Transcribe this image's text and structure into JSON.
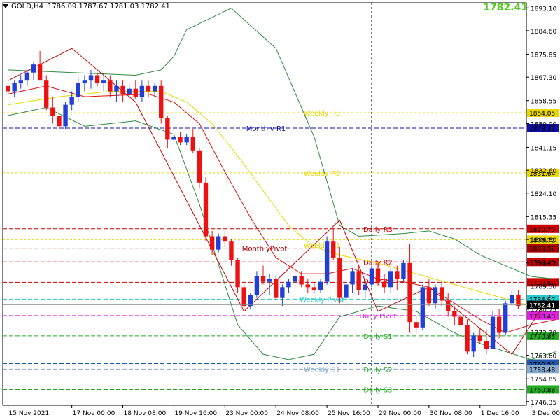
{
  "header": {
    "symbol_tf": "GOLD,H4",
    "ohlc": "1786.09 1787.67 1781.03 1782.41",
    "big_price": "1782.41"
  },
  "colors": {
    "bull": "#1f3fd8",
    "bear": "#ee1111",
    "grid": "#000000",
    "bb": "#2e8b3e",
    "ma_red": "#dd1111",
    "ma_yellow": "#e8d800",
    "zigzag": "#cc0000",
    "current_price_tag": "#000000"
  },
  "chart_data": {
    "type": "candlestick",
    "title": "GOLD,H4",
    "ylim": [
      1745,
      1895
    ],
    "y_ticks": [
      "1893.10",
      "1884.60",
      "1875.85",
      "1867.30",
      "1858.55",
      "1850.00",
      "1841.15",
      "1832.60",
      "1824.10",
      "1815.35",
      "1806.80",
      "1798.05",
      "1789.50",
      "1780.75",
      "1772.20",
      "1763.60",
      "1754.85",
      "1746.35"
    ],
    "x_ticks": [
      {
        "label": "15 Nov 2021",
        "x": 0
      },
      {
        "label": "17 Nov 00:00",
        "x": 10
      },
      {
        "label": "18 Nov 08:00",
        "x": 18
      },
      {
        "label": "19 Nov 16:00",
        "x": 26
      },
      {
        "label": "23 Nov 00:00",
        "x": 34
      },
      {
        "label": "24 Nov 08:00",
        "x": 42
      },
      {
        "label": "25 Nov 16:00",
        "x": 50
      },
      {
        "label": "29 Nov 00:00",
        "x": 58
      },
      {
        "label": "30 Nov 08:00",
        "x": 66
      },
      {
        "label": "1 Dec 16:00",
        "x": 74
      },
      {
        "label": "3 Dec 00:00",
        "x": 82
      }
    ],
    "vlines_x": [
      26,
      57,
      87
    ],
    "candles": [
      [
        1864,
        1866,
        1861,
        1862
      ],
      [
        1862,
        1866,
        1860,
        1865
      ],
      [
        1865,
        1868,
        1863,
        1866
      ],
      [
        1866,
        1870,
        1864,
        1869
      ],
      [
        1869,
        1873,
        1866,
        1872
      ],
      [
        1872,
        1877,
        1868,
        1866
      ],
      [
        1866,
        1868,
        1855,
        1856
      ],
      [
        1856,
        1860,
        1850,
        1853
      ],
      [
        1853,
        1856,
        1847,
        1849
      ],
      [
        1849,
        1858,
        1848,
        1857
      ],
      [
        1857,
        1862,
        1855,
        1860
      ],
      [
        1860,
        1867,
        1858,
        1865
      ],
      [
        1865,
        1868,
        1862,
        1866
      ],
      [
        1866,
        1870,
        1863,
        1868
      ],
      [
        1868,
        1869,
        1864,
        1865
      ],
      [
        1865,
        1868,
        1862,
        1866
      ],
      [
        1866,
        1868,
        1860,
        1862
      ],
      [
        1862,
        1866,
        1858,
        1864
      ],
      [
        1864,
        1866,
        1858,
        1861
      ],
      [
        1861,
        1865,
        1860,
        1863
      ],
      [
        1863,
        1866,
        1859,
        1860
      ],
      [
        1860,
        1866,
        1858,
        1864
      ],
      [
        1864,
        1866,
        1860,
        1862
      ],
      [
        1862,
        1865,
        1860,
        1864
      ],
      [
        1864,
        1866,
        1850,
        1852
      ],
      [
        1852,
        1853,
        1841,
        1844
      ],
      [
        1844,
        1848,
        1842,
        1845
      ],
      [
        1845,
        1847,
        1842,
        1843
      ],
      [
        1843,
        1846,
        1842,
        1845
      ],
      [
        1845,
        1848,
        1839,
        1840
      ],
      [
        1840,
        1841,
        1826,
        1828
      ],
      [
        1828,
        1830,
        1806,
        1808
      ],
      [
        1808,
        1810,
        1801,
        1803
      ],
      [
        1803,
        1809,
        1802,
        1808
      ],
      [
        1808,
        1810,
        1804,
        1806
      ],
      [
        1806,
        1807,
        1797,
        1799
      ],
      [
        1799,
        1800,
        1787,
        1789
      ],
      [
        1789,
        1790,
        1781,
        1782
      ],
      [
        1782,
        1787,
        1781,
        1786
      ],
      [
        1786,
        1795,
        1785,
        1793
      ],
      [
        1793,
        1797,
        1790,
        1791
      ],
      [
        1791,
        1794,
        1786,
        1792
      ],
      [
        1792,
        1793,
        1784,
        1785
      ],
      [
        1785,
        1790,
        1782,
        1789
      ],
      [
        1789,
        1792,
        1787,
        1791
      ],
      [
        1791,
        1794,
        1789,
        1793
      ],
      [
        1793,
        1795,
        1789,
        1790
      ],
      [
        1790,
        1792,
        1787,
        1789
      ],
      [
        1789,
        1791,
        1787,
        1788
      ],
      [
        1788,
        1792,
        1787,
        1791
      ],
      [
        1791,
        1808,
        1790,
        1806
      ],
      [
        1806,
        1811,
        1799,
        1800
      ],
      [
        1800,
        1804,
        1783,
        1785
      ],
      [
        1785,
        1791,
        1781,
        1790
      ],
      [
        1790,
        1796,
        1787,
        1795
      ],
      [
        1795,
        1797,
        1786,
        1788
      ],
      [
        1788,
        1791,
        1785,
        1790
      ],
      [
        1790,
        1797,
        1789,
        1796
      ],
      [
        1796,
        1798,
        1790,
        1791
      ],
      [
        1791,
        1794,
        1787,
        1789
      ],
      [
        1789,
        1796,
        1787,
        1795
      ],
      [
        1795,
        1797,
        1788,
        1792
      ],
      [
        1792,
        1799,
        1791,
        1798
      ],
      [
        1798,
        1805,
        1772,
        1776
      ],
      [
        1776,
        1778,
        1772,
        1774
      ],
      [
        1774,
        1790,
        1773,
        1789
      ],
      [
        1789,
        1792,
        1782,
        1783
      ],
      [
        1783,
        1790,
        1781,
        1789
      ],
      [
        1789,
        1791,
        1782,
        1784
      ],
      [
        1784,
        1787,
        1778,
        1780
      ],
      [
        1780,
        1782,
        1775,
        1778
      ],
      [
        1778,
        1780,
        1773,
        1775
      ],
      [
        1775,
        1777,
        1764,
        1765
      ],
      [
        1765,
        1772,
        1763,
        1771
      ],
      [
        1771,
        1774,
        1768,
        1769
      ],
      [
        1769,
        1773,
        1764,
        1766
      ],
      [
        1766,
        1780,
        1766,
        1778
      ],
      [
        1778,
        1781,
        1770,
        1772
      ],
      [
        1772,
        1784,
        1771,
        1783
      ],
      [
        1783,
        1788,
        1782,
        1786
      ],
      [
        1786,
        1788,
        1781,
        1782
      ]
    ],
    "levels": [
      {
        "label": "Weekly R3",
        "value": 1854.05,
        "price_tag": "1854.05",
        "color": "#e8d800",
        "dash": "3,3"
      },
      {
        "label": "Monthly R1",
        "value": 1848.31,
        "price_tag": "1848.31",
        "color": "#1111aa",
        "dash": "6,3"
      },
      {
        "label": "Weekly R2",
        "value": 1831.64,
        "price_tag": "1831.64",
        "color": "#e8d800",
        "dash": "3,3"
      },
      {
        "label": "Daily R3",
        "value": 1810.79,
        "price_tag": "1810.79",
        "color": "#cc0000",
        "dash": "6,3"
      },
      {
        "label": "",
        "value": 1806.72,
        "price_tag": "1806.72",
        "color": "#e8d800",
        "dash": "3,3"
      },
      {
        "label": "MonthlyPivot",
        "value": 1803.52,
        "price_tag": "1803.52",
        "color": "#aa0000",
        "dash": "6,3"
      },
      {
        "label": "Daily R2",
        "value": 1798.4,
        "price_tag": "1798.40",
        "color": "#cc0000",
        "dash": "6,3"
      },
      {
        "label": "",
        "value": 1790.82,
        "price_tag": "1790.82",
        "color": "#cc0000",
        "dash": "6,3"
      },
      {
        "label": "Weekly Pivot",
        "value": 1784.57,
        "price_tag": "1784.57",
        "color": "#22cccc",
        "dash": "6,3"
      },
      {
        "label": "Daily Pivot",
        "value": 1778.43,
        "price_tag": "1778.43",
        "color": "#dd22dd",
        "dash": "6,3"
      },
      {
        "label": "Daily S1",
        "value": 1770.85,
        "price_tag": "1770.85",
        "color": "#22aa22",
        "dash": "6,3"
      },
      {
        "label": "",
        "value": 1760.52,
        "price_tag": "1760.52",
        "color": "#2255aa",
        "dash": "6,3"
      },
      {
        "label": "Weekly S1",
        "value": 1758.48,
        "price_tag": "1758.48",
        "color": "#88aacc",
        "dash": "6,3"
      },
      {
        "label": "Daily S3",
        "value": 1750.88,
        "price_tag": "1750.88",
        "color": "#22aa22",
        "dash": "6,3"
      }
    ],
    "partial_labels": [
      {
        "label": "Daily R1",
        "value": 1791.3,
        "color": "#cc0000"
      },
      {
        "label": "Weekly R1",
        "value": 1804.8,
        "color": "#e8d800"
      },
      {
        "label": "Daily S2",
        "value": 1758.3,
        "color": "#22aa22"
      }
    ],
    "current_price": {
      "value": 1782.41,
      "label": "1782.41"
    },
    "zigzag": [
      [
        0,
        1866
      ],
      [
        10,
        1878
      ],
      [
        20,
        1858
      ],
      [
        37,
        1780
      ],
      [
        52,
        1814
      ],
      [
        58,
        1780
      ],
      [
        66,
        1789
      ],
      [
        79,
        1764
      ],
      [
        85,
        1786
      ]
    ],
    "bb_upper": [
      [
        0,
        1870
      ],
      [
        20,
        1868
      ],
      [
        24,
        1870
      ],
      [
        26,
        1875
      ],
      [
        28,
        1885
      ],
      [
        35,
        1893
      ],
      [
        42,
        1878
      ],
      [
        48,
        1845
      ],
      [
        52,
        1812
      ],
      [
        55,
        1808
      ],
      [
        62,
        1809
      ],
      [
        66,
        1810
      ],
      [
        70,
        1807
      ],
      [
        74,
        1801
      ],
      [
        78,
        1797
      ],
      [
        82,
        1793
      ],
      [
        86,
        1792
      ]
    ],
    "bb_lower": [
      [
        0,
        1853
      ],
      [
        6,
        1856
      ],
      [
        12,
        1849
      ],
      [
        20,
        1851
      ],
      [
        26,
        1846
      ],
      [
        30,
        1820
      ],
      [
        36,
        1775
      ],
      [
        40,
        1764
      ],
      [
        44,
        1762
      ],
      [
        48,
        1764
      ],
      [
        52,
        1778
      ],
      [
        58,
        1782
      ],
      [
        64,
        1780
      ],
      [
        70,
        1772
      ],
      [
        74,
        1768
      ],
      [
        78,
        1765
      ],
      [
        82,
        1762
      ],
      [
        86,
        1765
      ]
    ],
    "ma_red": [
      [
        0,
        1861
      ],
      [
        6,
        1864
      ],
      [
        12,
        1860
      ],
      [
        22,
        1861
      ],
      [
        26,
        1858
      ],
      [
        30,
        1850
      ],
      [
        34,
        1832
      ],
      [
        38,
        1815
      ],
      [
        42,
        1800
      ],
      [
        46,
        1794
      ],
      [
        50,
        1794
      ],
      [
        54,
        1796
      ],
      [
        58,
        1792
      ],
      [
        62,
        1791
      ],
      [
        66,
        1789
      ],
      [
        70,
        1783
      ],
      [
        74,
        1777
      ],
      [
        78,
        1772
      ],
      [
        82,
        1775
      ],
      [
        86,
        1777
      ]
    ],
    "ma_yellow": [
      [
        0,
        1857
      ],
      [
        8,
        1860
      ],
      [
        16,
        1862
      ],
      [
        24,
        1862
      ],
      [
        28,
        1858
      ],
      [
        32,
        1850
      ],
      [
        36,
        1838
      ],
      [
        40,
        1825
      ],
      [
        44,
        1812
      ],
      [
        48,
        1804
      ],
      [
        52,
        1801
      ],
      [
        58,
        1798
      ],
      [
        64,
        1794
      ],
      [
        70,
        1790
      ],
      [
        76,
        1786
      ],
      [
        82,
        1782
      ],
      [
        86,
        1781
      ]
    ]
  }
}
